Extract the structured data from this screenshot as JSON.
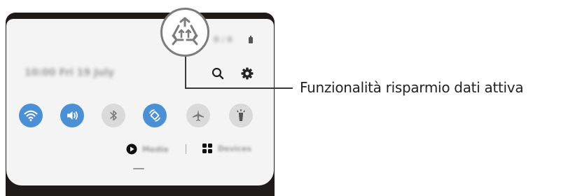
{
  "status_bar": {
    "time_blurred": "10:00 Fri 19 July",
    "right_blurred": "0 / 6"
  },
  "quick_panel": {
    "tiles": [
      {
        "name": "wifi",
        "state": "on"
      },
      {
        "name": "sound",
        "state": "on"
      },
      {
        "name": "bluetooth",
        "state": "off"
      },
      {
        "name": "auto-rotate",
        "state": "on"
      },
      {
        "name": "airplane-mode",
        "state": "off"
      },
      {
        "name": "flashlight",
        "state": "off"
      }
    ],
    "media_label": "Media",
    "devices_label": "Devices"
  },
  "callout": {
    "label": "Funzionalità risparmio dati attiva",
    "icon": "data-saver-icon"
  },
  "colors": {
    "tile_on": "#4b8fd4",
    "tile_off": "#dadada",
    "panel": "#f4f4f4",
    "background_dark": "#1f1a16"
  }
}
